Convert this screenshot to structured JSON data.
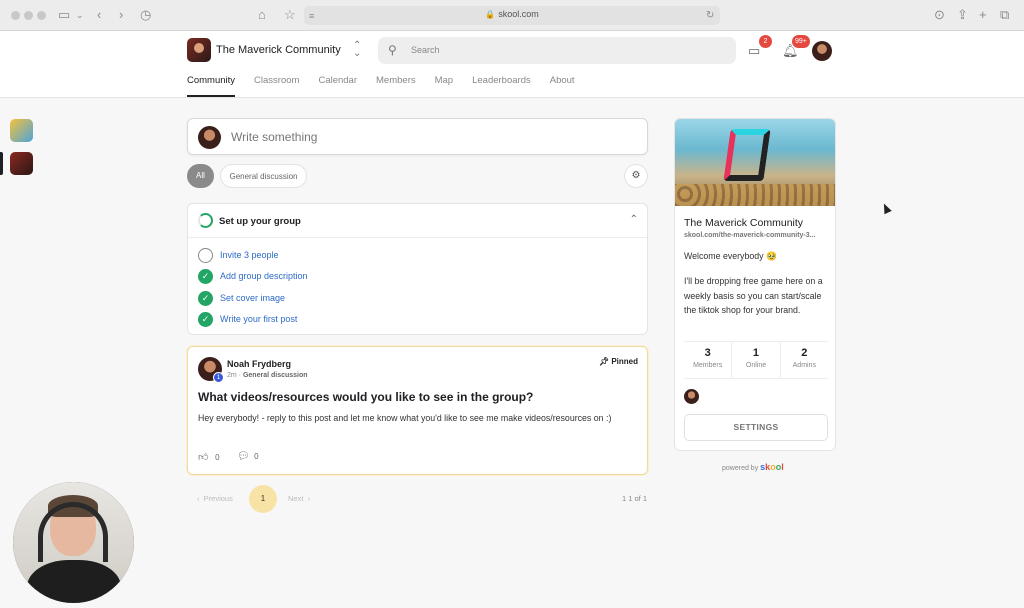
{
  "browser": {
    "url": "skool.com"
  },
  "header": {
    "community_name": "The Maverick Community",
    "search_placeholder": "Search",
    "chat_badge": "2",
    "notif_badge": "99+",
    "tabs": [
      {
        "label": "Community",
        "active": true
      },
      {
        "label": "Classroom"
      },
      {
        "label": "Calendar"
      },
      {
        "label": "Members"
      },
      {
        "label": "Map"
      },
      {
        "label": "Leaderboards"
      },
      {
        "label": "About"
      }
    ]
  },
  "composer": {
    "placeholder": "Write something"
  },
  "filters": {
    "all": "All",
    "general": "General discussion"
  },
  "setup": {
    "title": "Set up your group",
    "tasks": [
      {
        "label": "Invite 3 people",
        "done": false
      },
      {
        "label": "Add group description",
        "done": true
      },
      {
        "label": "Set cover image",
        "done": true
      },
      {
        "label": "Write your first post",
        "done": true
      }
    ]
  },
  "post": {
    "author": "Noah Frydberg",
    "level": "1",
    "time": "2m",
    "category": "General discussion",
    "pinned_label": "Pinned",
    "title": "What videos/resources would you like to see in the group?",
    "body": "Hey everybody! - reply to this post and let me know what you'd like to see me make videos/resources on :)",
    "likes": "0",
    "comments": "0"
  },
  "pagination": {
    "previous": "Previous",
    "current": "1",
    "next": "Next",
    "count": "1 1 of 1"
  },
  "sidebar": {
    "name": "The Maverick Community",
    "url": "skool.com/the-maverick-community-3...",
    "welcome": "Welcome everybody 🥹",
    "description": "I'll be dropping free game here on a weekly basis so you can start/scale the tiktok shop for your brand.",
    "stats": [
      {
        "value": "3",
        "label": "Members"
      },
      {
        "value": "1",
        "label": "Online"
      },
      {
        "value": "2",
        "label": "Admins"
      }
    ],
    "settings_label": "SETTINGS",
    "powered_by": "powered by",
    "brand": "skool"
  },
  "colors": {
    "accent_green": "#22a565",
    "link_blue": "#2e6cc7",
    "badge_red": "#e5483f",
    "pin_highlight": "#f8e3a6"
  }
}
